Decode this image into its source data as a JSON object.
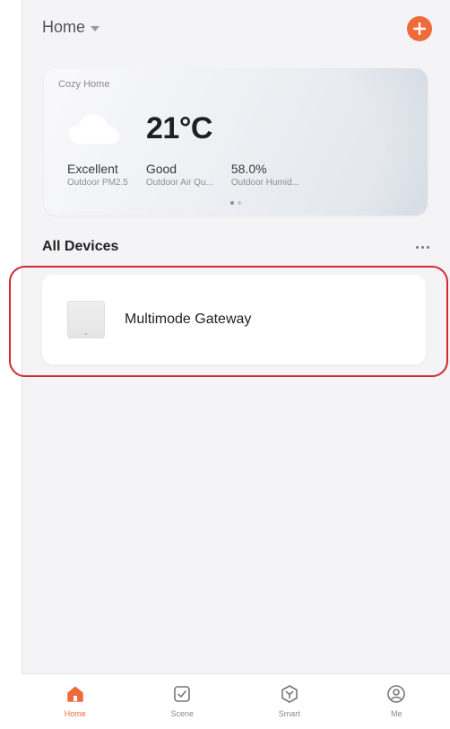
{
  "header": {
    "home_label": "Home"
  },
  "weather": {
    "home_name": "Cozy Home",
    "temperature": "21°C",
    "stats": [
      {
        "value": "Excellent",
        "label": "Outdoor PM2.5"
      },
      {
        "value": "Good",
        "label": "Outdoor Air Qu..."
      },
      {
        "value": "58.0%",
        "label": "Outdoor Humid..."
      }
    ],
    "pager": {
      "count": 2,
      "active_index": 0
    }
  },
  "devices": {
    "title": "All Devices",
    "items": [
      {
        "name": "Multimode Gateway"
      }
    ]
  },
  "tabbar": {
    "tabs": [
      {
        "label": "Home",
        "icon": "home-icon",
        "active": true
      },
      {
        "label": "Scene",
        "icon": "scene-check-icon",
        "active": false
      },
      {
        "label": "Smart",
        "icon": "smart-icon",
        "active": false
      },
      {
        "label": "Me",
        "icon": "profile-icon",
        "active": false
      }
    ]
  },
  "colors": {
    "accent": "#f06a3a",
    "highlight": "#d0292f",
    "background": "#f4f4f6"
  }
}
